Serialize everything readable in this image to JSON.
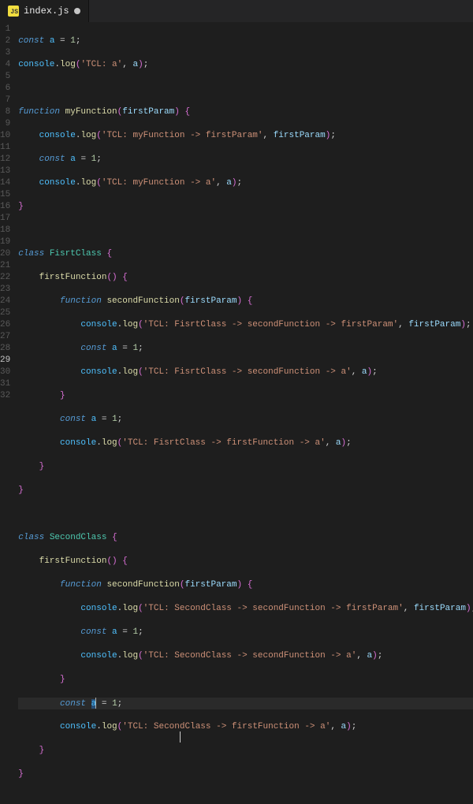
{
  "tab": {
    "icon_label": "JS",
    "filename": "index.js",
    "dirty": true
  },
  "active_line": 29,
  "gutter": [
    "1",
    "2",
    "3",
    "4",
    "5",
    "6",
    "7",
    "8",
    "9",
    "10",
    "11",
    "12",
    "13",
    "14",
    "15",
    "16",
    "17",
    "18",
    "19",
    "20",
    "21",
    "22",
    "23",
    "24",
    "25",
    "26",
    "27",
    "28",
    "29",
    "30",
    "31",
    "32"
  ],
  "tokens": {
    "const": "const",
    "function": "function",
    "class": "class",
    "log": "log",
    "console": "console",
    "a": "a",
    "one": "1",
    "firstParam": "firstParam",
    "myFunction": "myFunction",
    "FisrtClass": "FisrtClass",
    "SecondClass": "SecondClass",
    "firstFunction": "firstFunction",
    "secondFunction": "secondFunction"
  },
  "strings": {
    "tcl_a": "'TCL: a'",
    "tcl_myfn_fp": "'TCL: myFunction -> firstParam'",
    "tcl_myfn_a": "'TCL: myFunction -> a'",
    "tcl_fc_sf_fp": "'TCL: FisrtClass -> secondFunction -> firstParam'",
    "tcl_fc_sf_a": "'TCL: FisrtClass -> secondFunction -> a'",
    "tcl_fc_ff_a": "'TCL: FisrtClass -> firstFunction -> a'",
    "tcl_sc_sf_fp": "'TCL: SecondClass -> secondFunction -> firstParam'",
    "tcl_sc_sf_a": "'TCL: SecondClass -> secondFunction -> a'",
    "tcl_sc_ff_a_pre": "'TCL: Secon",
    "tcl_sc_ff_a_post": "Class -> firstFunction -> a'"
  },
  "punct": {
    "eq": " = ",
    "semi": ";",
    "dot": ".",
    "comma": ", ",
    "ob": "{",
    "cb": "}",
    "op": "(",
    "cp": ")",
    "opcp": "()",
    "sp": " "
  },
  "indent": {
    "i1": "    ",
    "i2": "        ",
    "i3": "            "
  }
}
